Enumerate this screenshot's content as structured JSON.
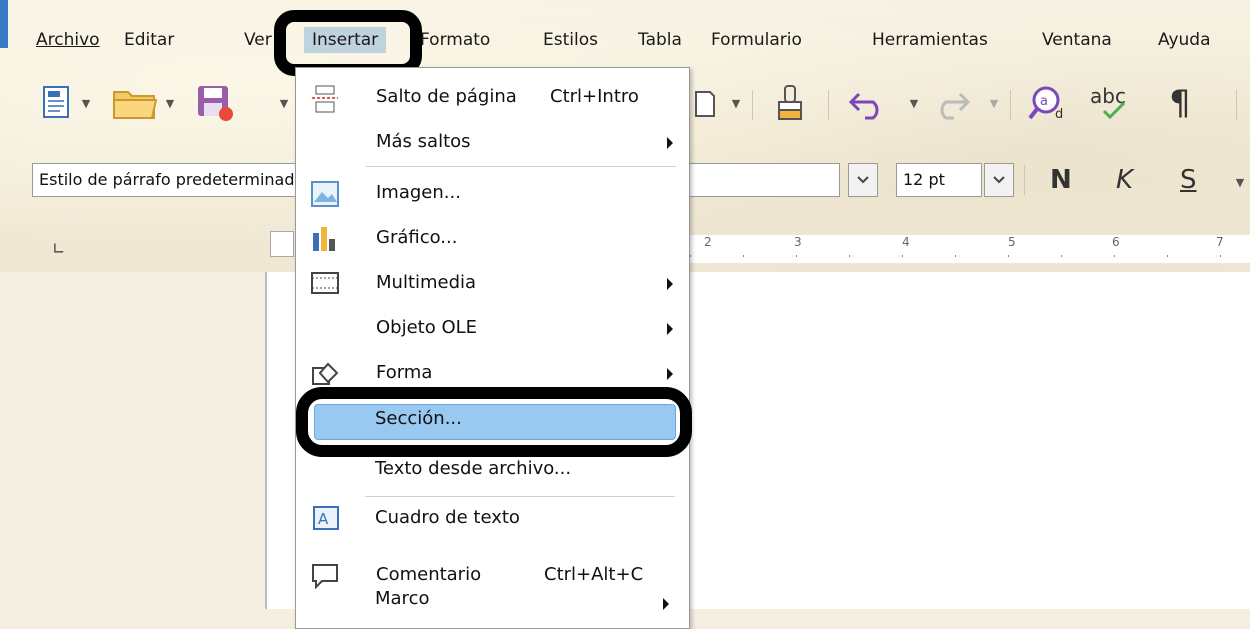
{
  "menubar": {
    "items": [
      "Archivo",
      "Editar",
      "Ver",
      "Insertar",
      "Formato",
      "Estilos",
      "Tabla",
      "Formulario",
      "Herramientas",
      "Ventana",
      "Ayuda"
    ],
    "active": "Insertar"
  },
  "formatting": {
    "paragraph_style": "Estilo de párrafo predeterminado",
    "font_size": "12 pt",
    "bold": "N",
    "italic": "K",
    "underline": "S"
  },
  "toolbar_icons": [
    "new-document-icon",
    "open-folder-icon",
    "save-icon",
    "clone-formatting-icon",
    "undo-icon",
    "redo-icon",
    "find-replace-icon",
    "spellcheck-icon",
    "formatting-marks-icon"
  ],
  "ruler": {
    "numbers": [
      "3",
      "4",
      "5",
      "6",
      "7"
    ],
    "partial": "2"
  },
  "insert_menu": {
    "items": [
      {
        "label": "Salto de página",
        "shortcut": "Ctrl+Intro",
        "submenu": false,
        "icon": "page-break-icon"
      },
      {
        "label": "Más saltos",
        "shortcut": "",
        "submenu": true,
        "icon": ""
      },
      {
        "label": "Imagen...",
        "shortcut": "",
        "submenu": false,
        "icon": "image-icon"
      },
      {
        "label": "Gráfico...",
        "shortcut": "",
        "submenu": false,
        "icon": "chart-icon"
      },
      {
        "label": "Multimedia",
        "shortcut": "",
        "submenu": true,
        "icon": "multimedia-icon"
      },
      {
        "label": "Objeto OLE",
        "shortcut": "",
        "submenu": true,
        "icon": ""
      },
      {
        "label": "Forma",
        "shortcut": "",
        "submenu": true,
        "icon": "shape-icon"
      },
      {
        "label": "Sección...",
        "shortcut": "",
        "submenu": false,
        "icon": "",
        "highlighted": true
      },
      {
        "label": "Texto desde archivo...",
        "shortcut": "",
        "submenu": false,
        "icon": ""
      },
      {
        "label": "Cuadro de texto",
        "shortcut": "",
        "submenu": false,
        "icon": "text-box-icon"
      },
      {
        "label": "Comentario",
        "shortcut": "Ctrl+Alt+C",
        "submenu": false,
        "icon": "comment-icon"
      },
      {
        "label": "Marco",
        "shortcut": "",
        "submenu": true,
        "icon": ""
      }
    ]
  },
  "colors": {
    "highlight": "#99c9f0",
    "menubar_active": "#bfd3df",
    "accent": "#3a78c8"
  }
}
